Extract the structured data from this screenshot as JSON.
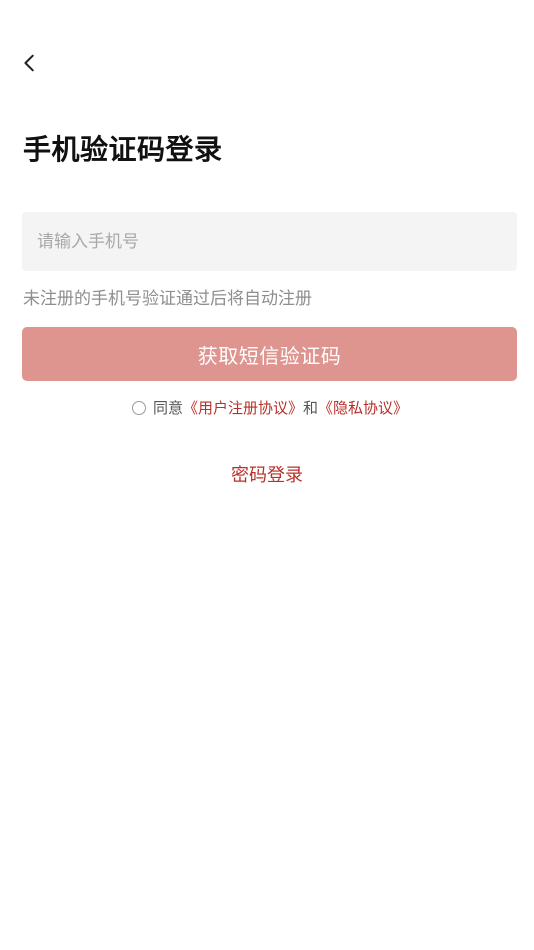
{
  "header": {
    "back_icon": "chevron-left-icon"
  },
  "main": {
    "title": "手机验证码登录",
    "phone_input": {
      "value": "",
      "placeholder": "请输入手机号"
    },
    "hint": "未注册的手机号验证通过后将自动注册",
    "get_code_label": "获取短信验证码",
    "agreement": {
      "checked": false,
      "prefix": "同意",
      "user_agreement_label": "《用户注册协议》",
      "conjunction": "和",
      "privacy_policy_label": "《隐私协议》"
    },
    "password_login_label": "密码登录"
  },
  "colors": {
    "accent": "#b8302a",
    "button_background": "#de948f",
    "input_background": "#f4f4f4",
    "hint_text": "#8e8e8e"
  }
}
